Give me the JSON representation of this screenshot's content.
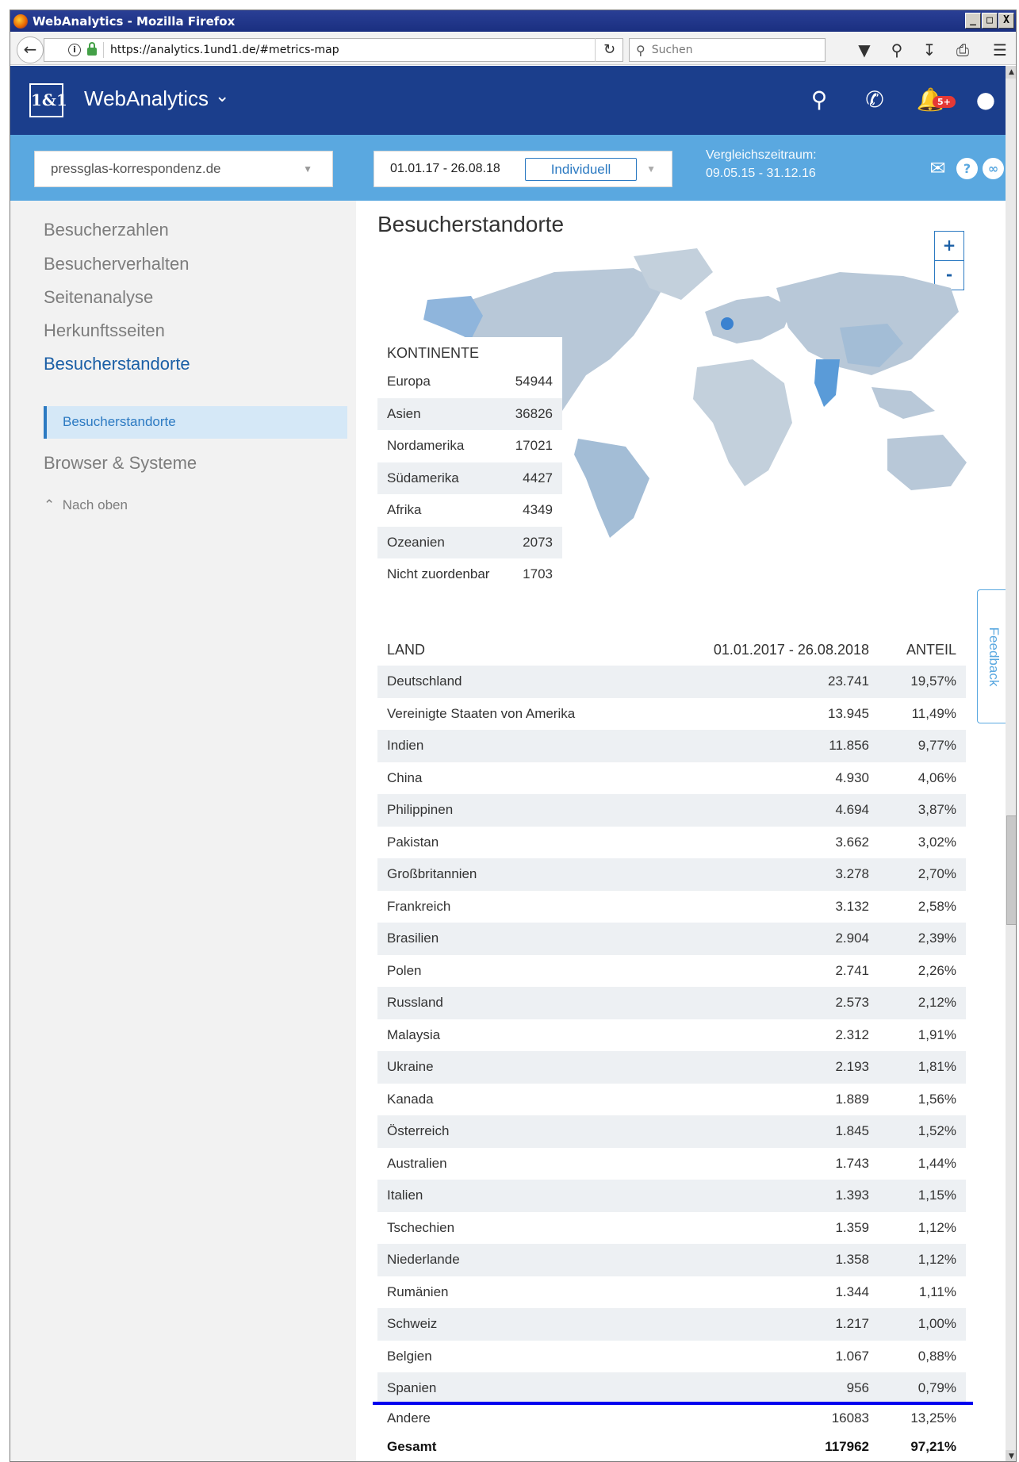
{
  "window": {
    "title": "WebAnalytics - Mozilla Firefox",
    "controls": [
      "_",
      "□",
      "X"
    ]
  },
  "browser": {
    "url": "https://analytics.1und1.de/#metrics-map",
    "search_placeholder": "Suchen"
  },
  "header": {
    "logo": "1&1",
    "app_title": "WebAnalytics",
    "notification_badge": "5+"
  },
  "filters": {
    "domain": "pressglas-korrespondenz.de",
    "date_range": "01.01.17 - 26.08.18",
    "mode_button": "Individuell",
    "compare_label": "Vergleichszeitraum:",
    "compare_range": "09.05.15 - 31.12.16"
  },
  "sidebar": {
    "items": [
      {
        "label": "Besucherzahlen",
        "active": false
      },
      {
        "label": "Besucherverhalten",
        "active": false
      },
      {
        "label": "Seitenanalyse",
        "active": false
      },
      {
        "label": "Herkunftsseiten",
        "active": false
      },
      {
        "label": "Besucherstandorte",
        "active": true
      },
      {
        "label": "Browser & Systeme",
        "active": false
      }
    ],
    "sub_active": "Besucherstandorte",
    "back_to_top": "Nach oben"
  },
  "main": {
    "title": "Besucherstandorte",
    "zoom_in": "+",
    "zoom_out": "-",
    "continents_header": "KONTINENTE",
    "continents": [
      {
        "name": "Europa",
        "value": "54944"
      },
      {
        "name": "Asien",
        "value": "36826"
      },
      {
        "name": "Nordamerika",
        "value": "17021"
      },
      {
        "name": "Südamerika",
        "value": "4427"
      },
      {
        "name": "Afrika",
        "value": "4349"
      },
      {
        "name": "Ozeanien",
        "value": "2073"
      },
      {
        "name": "Nicht zuordenbar",
        "value": "1703"
      }
    ],
    "table": {
      "col_country": "LAND",
      "col_period": "01.01.2017 - 26.08.2018",
      "col_share": "ANTEIL",
      "rows": [
        {
          "country": "Deutschland",
          "visits": "23.741",
          "share": "19,57%"
        },
        {
          "country": "Vereinigte Staaten von Amerika",
          "visits": "13.945",
          "share": "11,49%"
        },
        {
          "country": "Indien",
          "visits": "11.856",
          "share": "9,77%"
        },
        {
          "country": "China",
          "visits": "4.930",
          "share": "4,06%"
        },
        {
          "country": "Philippinen",
          "visits": "4.694",
          "share": "3,87%"
        },
        {
          "country": "Pakistan",
          "visits": "3.662",
          "share": "3,02%"
        },
        {
          "country": "Großbritannien",
          "visits": "3.278",
          "share": "2,70%"
        },
        {
          "country": "Frankreich",
          "visits": "3.132",
          "share": "2,58%"
        },
        {
          "country": "Brasilien",
          "visits": "2.904",
          "share": "2,39%"
        },
        {
          "country": "Polen",
          "visits": "2.741",
          "share": "2,26%"
        },
        {
          "country": "Russland",
          "visits": "2.573",
          "share": "2,12%"
        },
        {
          "country": "Malaysia",
          "visits": "2.312",
          "share": "1,91%"
        },
        {
          "country": "Ukraine",
          "visits": "2.193",
          "share": "1,81%"
        },
        {
          "country": "Kanada",
          "visits": "1.889",
          "share": "1,56%"
        },
        {
          "country": "Österreich",
          "visits": "1.845",
          "share": "1,52%"
        },
        {
          "country": "Australien",
          "visits": "1.743",
          "share": "1,44%"
        },
        {
          "country": "Italien",
          "visits": "1.393",
          "share": "1,15%"
        },
        {
          "country": "Tschechien",
          "visits": "1.359",
          "share": "1,12%"
        },
        {
          "country": "Niederlande",
          "visits": "1.358",
          "share": "1,12%"
        },
        {
          "country": "Rumänien",
          "visits": "1.344",
          "share": "1,11%"
        },
        {
          "country": "Schweiz",
          "visits": "1.217",
          "share": "1,00%"
        },
        {
          "country": "Belgien",
          "visits": "1.067",
          "share": "0,88%"
        },
        {
          "country": "Spanien",
          "visits": "956",
          "share": "0,79%"
        }
      ],
      "other": {
        "country": "Andere",
        "visits": "16083",
        "share": "13,25%"
      },
      "total": {
        "country": "Gesamt",
        "visits": "117962",
        "share": "97,21%"
      }
    }
  },
  "feedback_tab": "Feedback",
  "colors": {
    "header_blue": "#1b3e8c",
    "filter_blue": "#5aa8e0",
    "accent": "#2c7ac2",
    "row_alt": "#edf0f3",
    "map_land": "#b8c8d8",
    "map_mid": "#a3bdd6",
    "map_high": "#5a9bd8"
  }
}
